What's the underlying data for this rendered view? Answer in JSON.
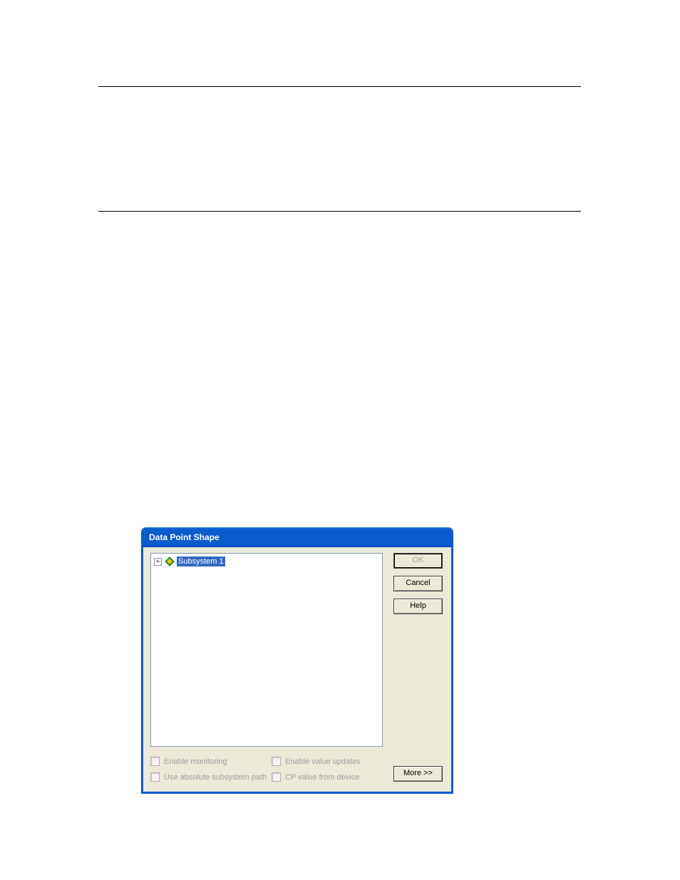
{
  "dialog": {
    "title": "Data Point Shape",
    "tree": {
      "root_label": "Subsystem 1",
      "root_icon": "subsystem-diamond-icon"
    },
    "buttons": {
      "ok": "OK",
      "cancel": "Cancel",
      "help": "Help",
      "more": "More >>"
    },
    "checkboxes": {
      "enable_monitoring": "Enable monitoring",
      "use_absolute_path": "Use absolute subsystem path",
      "enable_value_updates": "Enable value updates",
      "cp_value_from_device": "CP value from device"
    }
  }
}
